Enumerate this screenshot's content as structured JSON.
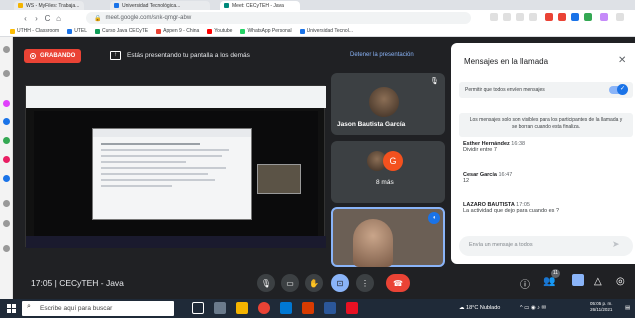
{
  "browser": {
    "tabs": [
      {
        "label": "WS - MyFiles: Trabaja..."
      },
      {
        "label": "Universidad Tecnológica..."
      },
      {
        "label": "Meet: CECyTEH - Java"
      }
    ],
    "url": "meet.google.com/snk-qmgr-abw",
    "bookmarks": [
      "UTHH - Classroom",
      "UTEL",
      "Curso Java CECyTE",
      "Appen 9 - China",
      "Youtube",
      "WhatsApp Personal",
      "Universidad Tecnol..."
    ],
    "colors": {
      "bar": "#dee1e6",
      "active_tab": "#ffffff"
    }
  },
  "meet": {
    "recording_label": "GRABANDO",
    "presenting_text": "Estás presentando tu pantalla a los demás",
    "stop_presenting": "Detener la presentación",
    "participants": [
      {
        "name": "Jason Bautista García"
      },
      {
        "name": "8 más",
        "avatar_letter": "G"
      }
    ],
    "meeting_info": "17:05 | CECyTEH - Java",
    "participant_count_badge": "11",
    "colors": {
      "background": "#202124",
      "tile": "#3c4043",
      "recording": "#ea4335",
      "accent": "#8ab4f8"
    },
    "controls": [
      "mic-icon",
      "camera-icon",
      "hand-icon",
      "present-icon",
      "more-icon",
      "hangup-icon"
    ],
    "right_controls": [
      "info-icon",
      "people-icon",
      "chat-icon",
      "activities-icon",
      "host-icon"
    ]
  },
  "chat": {
    "title": "Mensajes en la llamada",
    "allow_label": "Permitir que todos envíen mensajes",
    "allow_enabled": true,
    "info_text": "Los mensajes solo son visibles para los participantes de la llamada y se borran cuando esta finaliza.",
    "messages": [
      {
        "sender": "Esther Hernández",
        "time": "16:38",
        "text": "Dividir entre 7"
      },
      {
        "sender": "Cesar García",
        "time": "16:47",
        "text": "12"
      },
      {
        "sender": "LAZARO BAUTISTA",
        "time": "17:05",
        "text": "La actividad que dejo para cuando es ?"
      }
    ],
    "input_placeholder": "Envía un mensaje a todos"
  },
  "taskbar": {
    "search_placeholder": "Escribe aquí para buscar",
    "weather": "18°C Nublado",
    "time": "05:05 p. m.",
    "date": "26/11/2021"
  }
}
